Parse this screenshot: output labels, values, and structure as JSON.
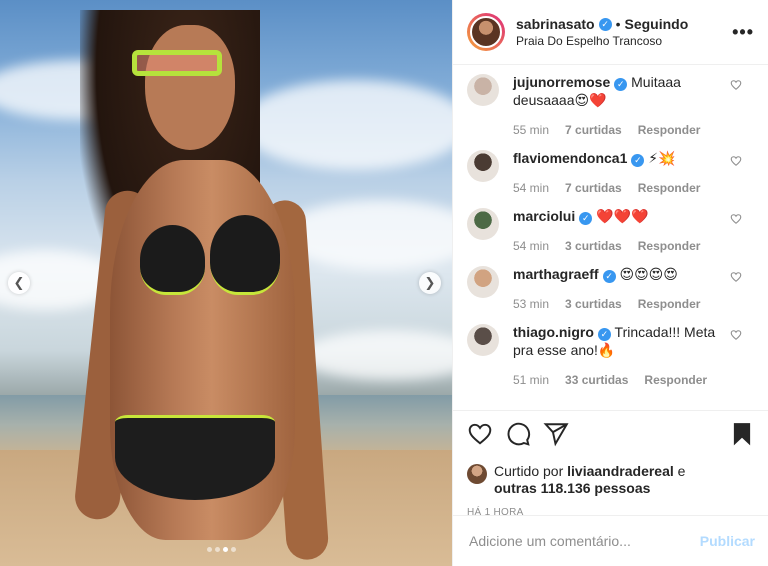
{
  "post": {
    "username": "sabrinasato",
    "follow_separator": "•",
    "follow_status": "Seguindo",
    "location": "Praia Do Espelho Trancoso",
    "more_icon": "more-horizontal-icon"
  },
  "carousel": {
    "prev_icon": "chevron-left-icon",
    "next_icon": "chevron-right-icon",
    "dot_count": 4,
    "active_dot": 3
  },
  "comments": [
    {
      "user": "jujunorremose",
      "verified": true,
      "text": "Muitaaa deusaaaa",
      "emoji": "😍❤️",
      "time": "55 min",
      "likes": "7 curtidas",
      "reply": "Responder",
      "avatar_color": "#c9b3a6"
    },
    {
      "user": "flaviomendonca1",
      "verified": true,
      "text": "",
      "emoji": "⚡💥",
      "time": "54 min",
      "likes": "7 curtidas",
      "reply": "Responder",
      "avatar_color": "#4a3b33"
    },
    {
      "user": "marciolui",
      "verified": true,
      "text": "",
      "emoji": "❤️❤️❤️",
      "time": "54 min",
      "likes": "3 curtidas",
      "reply": "Responder",
      "avatar_color": "#4d6a46"
    },
    {
      "user": "marthagraeff",
      "verified": true,
      "text": "",
      "emoji": "😍😍😍😍",
      "time": "53 min",
      "likes": "3 curtidas",
      "reply": "Responder",
      "avatar_color": "#d1a381"
    },
    {
      "user": "thiago.nigro",
      "verified": true,
      "text": "Trincada!!! Meta pra esse ano!",
      "emoji": "🔥",
      "time": "51 min",
      "likes": "33 curtidas",
      "reply": "Responder",
      "avatar_color": "#5a4e48"
    }
  ],
  "likes": {
    "prefix": "Curtido por",
    "first_user": "liviaandradereal",
    "connector": "e",
    "others": "outras 118.136 pessoas"
  },
  "time_ago": "HÁ 1 HORA",
  "add_comment": {
    "placeholder": "Adicione um comentário...",
    "publish_label": "Publicar"
  },
  "colors": {
    "verified": "#3897f0",
    "publish_disabled": "#b3dbff",
    "muted": "#8e8e8e"
  }
}
